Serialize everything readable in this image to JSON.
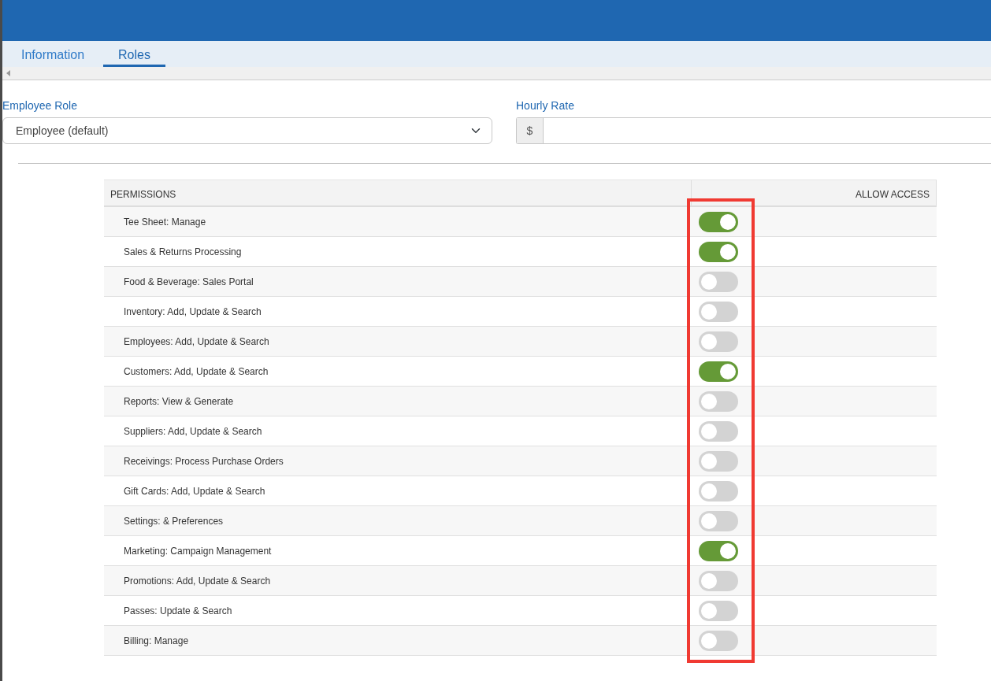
{
  "tabs": [
    {
      "label": "Information",
      "selected": false
    },
    {
      "label": "Roles",
      "selected": true
    }
  ],
  "employee_role": {
    "label": "Employee Role",
    "value": "Employee (default)"
  },
  "hourly_rate": {
    "label": "Hourly Rate",
    "prefix": "$"
  },
  "permissions": {
    "columns": [
      "PERMISSIONS",
      "ALLOW ACCESS"
    ],
    "rows": [
      {
        "name": "Tee Sheet: Manage",
        "on": true
      },
      {
        "name": "Sales & Returns Processing",
        "on": true
      },
      {
        "name": "Food & Beverage: Sales Portal",
        "on": false
      },
      {
        "name": "Inventory: Add, Update & Search",
        "on": false
      },
      {
        "name": "Employees: Add, Update & Search",
        "on": false
      },
      {
        "name": "Customers: Add, Update & Search",
        "on": true
      },
      {
        "name": "Reports: View & Generate",
        "on": false
      },
      {
        "name": "Suppliers: Add, Update & Search",
        "on": false
      },
      {
        "name": "Receivings: Process Purchase Orders",
        "on": false
      },
      {
        "name": "Gift Cards: Add, Update & Search",
        "on": false
      },
      {
        "name": "Settings: & Preferences",
        "on": false
      },
      {
        "name": "Marketing: Campaign Management",
        "on": true
      },
      {
        "name": "Promotions: Add, Update & Search",
        "on": false
      },
      {
        "name": "Passes: Update & Search",
        "on": false
      },
      {
        "name": "Billing: Manage",
        "on": false
      }
    ]
  }
}
